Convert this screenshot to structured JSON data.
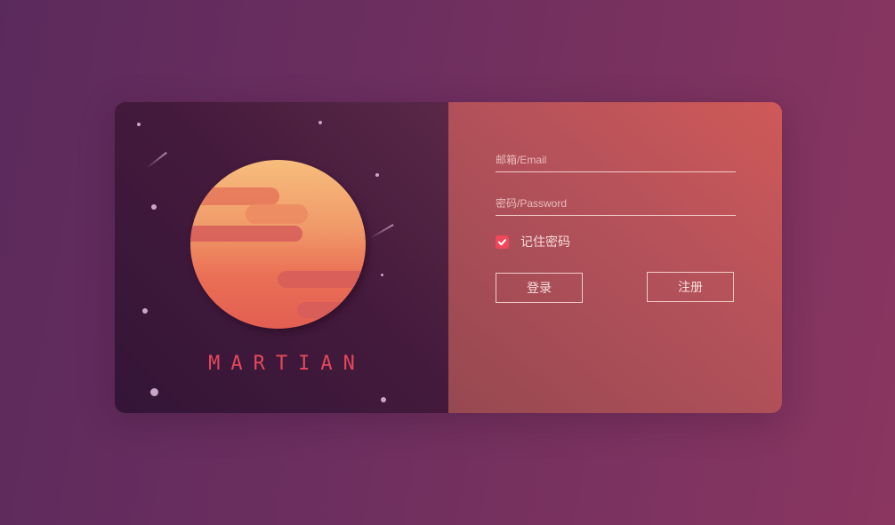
{
  "brand": {
    "name": "MARTIAN"
  },
  "form": {
    "email_placeholder": "邮箱/Email",
    "password_placeholder": "密码/Password",
    "remember_label": "记住密码",
    "remember_checked": true,
    "login_label": "登录",
    "register_label": "注册"
  },
  "colors": {
    "accent": "#e5485a",
    "checkbox": "#f2465c"
  },
  "icons": {
    "checkbox": "check-icon",
    "planet": "mars-planet-illustration"
  }
}
